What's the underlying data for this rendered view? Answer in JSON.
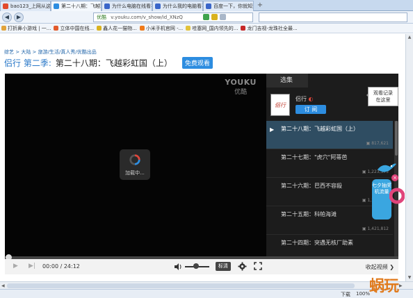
{
  "browser": {
    "tabs": [
      {
        "label": "bao123_上网从这里开始",
        "color": "#e24a2b",
        "active": false
      },
      {
        "label": "第二十八期：飞越彩虹国",
        "color": "#2d8de0",
        "active": true
      },
      {
        "label": "为什么电脑在线看视频一直",
        "color": "#3a66c9",
        "active": false
      },
      {
        "label": "为什么我的电脑看不成在线",
        "color": "#3a66c9",
        "active": false
      },
      {
        "label": "百度一下，你就知道",
        "color": "#3a66c9",
        "active": false
      }
    ],
    "new_tab": "+",
    "back": "◀",
    "forward": "▶",
    "url": "v.youku.com/v_show/id_XNzQ",
    "site_badge": "优酷",
    "bookmarks": [
      "打折鼻小游戏 | 一...",
      "立体中国在线...",
      "鑫人花一猫物...",
      "小米手机官网 -...",
      "哇塞网_国内领先的...",
      "龙门吉视-龙珠社全最..."
    ]
  },
  "page": {
    "breadcrumb": "综艺 > 大陆 > 旅游/生活/真人秀/优酷出品",
    "show_name": "侣行 第二季:",
    "episode_name": "第二十八期：飞越彩虹国（上）",
    "free_button": "免费观看"
  },
  "player": {
    "logo_line1": "YOUKU",
    "logo_line2": "优酷",
    "loading": "加载中...",
    "panel_tab": "选集",
    "uploader": "侣行",
    "avatar_text": "侣行",
    "subscribe": "订 阅",
    "episodes": [
      {
        "title": "第二十八期：飞越彩虹国（上）",
        "views": "817,621",
        "current": true
      },
      {
        "title": "第二十七期：\"虎穴\"阿蒂芭",
        "views": "1,223,375",
        "current": false
      },
      {
        "title": "第二十六期：巴西不容殺",
        "views": "1,107,813",
        "current": false
      },
      {
        "title": "第二十五期：科帕海滩",
        "views": "1,421,812",
        "current": false
      },
      {
        "title": "第二十四期：突遇无核厂助素",
        "views": "",
        "current": false
      }
    ],
    "history_tip": "观看记录\n在这里",
    "promo_text": "七夕抽奖机流量",
    "time": "00:00 / 24:12",
    "quality": "标清",
    "more_link": "收起视频",
    "progress_fraction": 0.0,
    "volume_fraction": 0.45
  },
  "status": {
    "download": "下载",
    "zoom": "100%"
  },
  "watermark": {
    "brand": "蜗玩"
  },
  "colors": {
    "youku_blue": "#2d8de0",
    "current_episode": "#2f4d62"
  }
}
